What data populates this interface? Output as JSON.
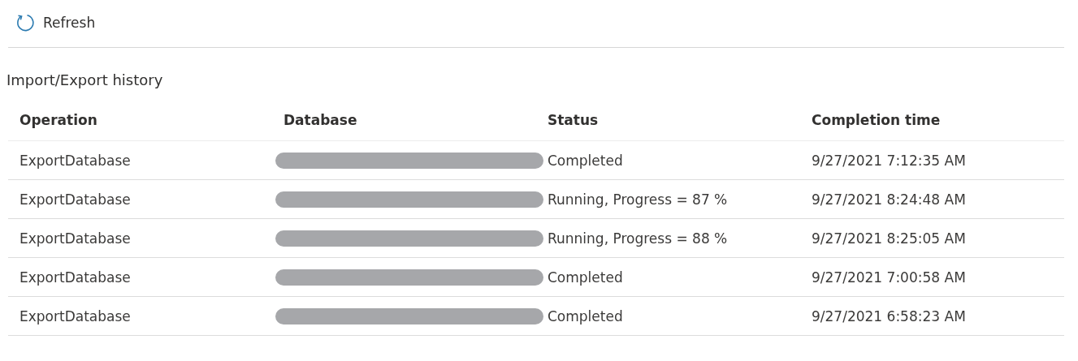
{
  "toolbar": {
    "refresh_label": "Refresh"
  },
  "section_title": "Import/Export history",
  "table": {
    "columns": [
      "Operation",
      "Database",
      "Status",
      "Completion time"
    ],
    "rows": [
      {
        "operation": "ExportDatabase",
        "database_redacted": true,
        "status": "Completed",
        "completion_time": "9/27/2021 7:12:35 AM"
      },
      {
        "operation": "ExportDatabase",
        "database_redacted": true,
        "status": "Running, Progress = 87 %",
        "completion_time": "9/27/2021 8:24:48 AM"
      },
      {
        "operation": "ExportDatabase",
        "database_redacted": true,
        "status": "Running, Progress = 88 %",
        "completion_time": "9/27/2021 8:25:05 AM"
      },
      {
        "operation": "ExportDatabase",
        "database_redacted": true,
        "status": "Completed",
        "completion_time": "9/27/2021 7:00:58 AM"
      },
      {
        "operation": "ExportDatabase",
        "database_redacted": true,
        "status": "Completed",
        "completion_time": "9/27/2021 6:58:23 AM"
      }
    ]
  }
}
